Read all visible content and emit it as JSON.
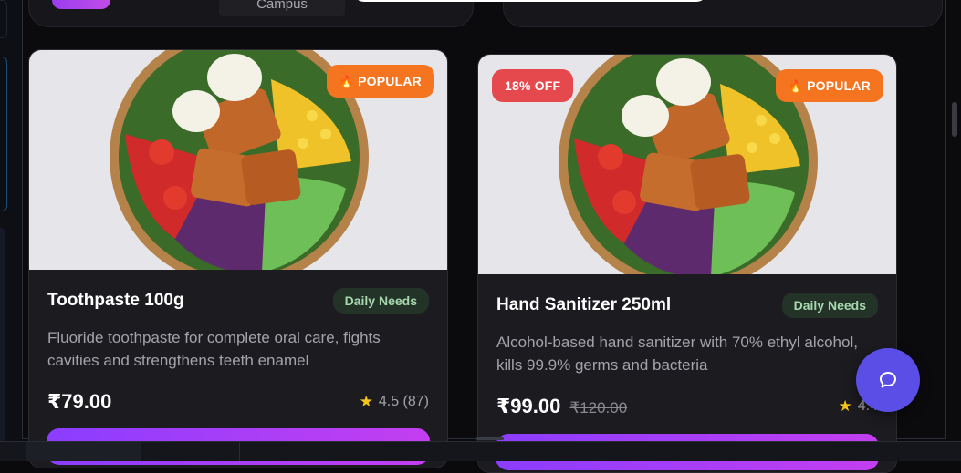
{
  "header": {
    "campus_tab_label": "Campus"
  },
  "products": [
    {
      "title": "Toothpaste 100g",
      "category": "Daily Needs",
      "description": "Fluoride toothpaste for complete oral care, fights cavities and strengthens teeth enamel",
      "price": "₹79.00",
      "old_price": "",
      "rating": "4.5 (87)",
      "popular_badge": "POPULAR",
      "discount_badge": ""
    },
    {
      "title": "Hand Sanitizer 250ml",
      "category": "Daily Needs",
      "description": "Alcohol-based hand sanitizer with 70% ethyl alcohol, kills 99.9% germs and bacteria",
      "price": "₹99.00",
      "old_price": "₹120.00",
      "rating": "4.4",
      "popular_badge": "POPULAR",
      "discount_badge": "18% OFF"
    }
  ],
  "icons": {
    "popular": "flame-icon",
    "rating": "star-icon",
    "chat": "chat-bubble-icon"
  },
  "colors": {
    "popular_badge": "#f5741f",
    "discount_badge": "#e5484d",
    "category_badge_bg": "#243328",
    "category_badge_text": "#a8d8b0",
    "add_button_start": "#8b3dff",
    "add_button_end": "#c43ef0",
    "chat_fab": "#5b4ee6",
    "star": "#f5c518"
  }
}
